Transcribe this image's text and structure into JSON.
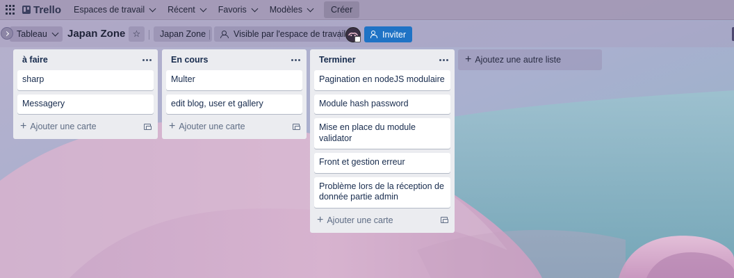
{
  "topnav": {
    "logo": "Trello",
    "menus": [
      {
        "label": "Espaces de travail"
      },
      {
        "label": "Récent"
      },
      {
        "label": "Favoris"
      },
      {
        "label": "Modèles"
      }
    ],
    "create_label": "Créer"
  },
  "board": {
    "view_label": "Tableau",
    "title": "Japan Zone",
    "workspace_label": "Japan Zone",
    "visibility_label": "Visible par l'espace de travail",
    "invite_label": "Inviter"
  },
  "lists": [
    {
      "title": "à faire",
      "cards": [
        "sharp",
        "Messagery"
      ],
      "add_card_label": "Ajouter une carte"
    },
    {
      "title": "En cours",
      "cards": [
        "Multer",
        "edit blog, user et gallery"
      ],
      "add_card_label": "Ajouter une carte"
    },
    {
      "title": "Terminer",
      "cards": [
        "Pagination en nodeJS modulaire",
        "Module hash password",
        "Mise en place du module validator",
        "Front et gestion erreur",
        "Problème lors de la réception de donnée partie admin"
      ],
      "add_card_label": "Ajouter une carte"
    }
  ],
  "add_list_label": "Ajoutez une autre liste",
  "colors": {
    "invite_button": "#1f73c5",
    "list_bg": "#ebecf0",
    "card_bg": "#ffffff"
  }
}
